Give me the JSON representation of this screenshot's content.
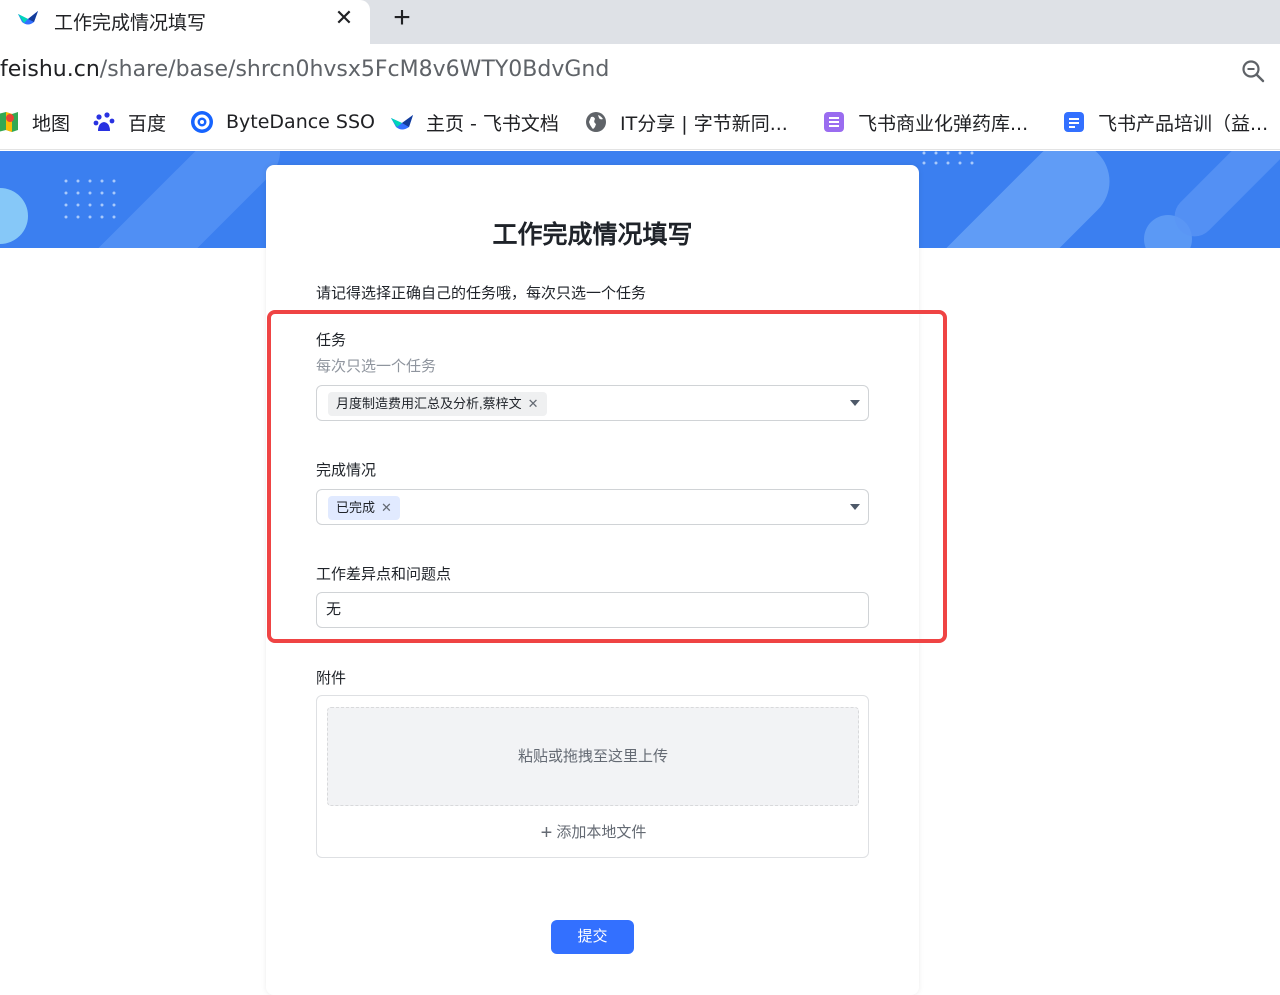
{
  "browser": {
    "tab_title": "工作完成情况填写",
    "tab_close": "✕",
    "new_tab": "+",
    "url_host": "feishu.cn",
    "url_path": "/share/base/shrcn0hvsx5FcM8v6WTY0BdvGnd"
  },
  "bookmarks": [
    {
      "label": "地图",
      "icon": "maps-icon"
    },
    {
      "label": "百度",
      "icon": "baidu-icon"
    },
    {
      "label": "ByteDance SSO",
      "icon": "sso-icon"
    },
    {
      "label": "主页 - 飞书文档",
      "icon": "feishu-icon"
    },
    {
      "label": "IT分享 | 字节新同...",
      "icon": "globe-icon"
    },
    {
      "label": "飞书商业化弹药库...",
      "icon": "list-doc-icon"
    },
    {
      "label": "飞书产品培训（益...",
      "icon": "doc-icon"
    }
  ],
  "form": {
    "title": "工作完成情况填写",
    "description": "请记得选择正确自己的任务哦，每次只选一个任务",
    "task": {
      "label": "任务",
      "hint": "每次只选一个任务",
      "selected": "月度制造费用汇总及分析,蔡梓文"
    },
    "status": {
      "label": "完成情况",
      "selected": "已完成"
    },
    "issues": {
      "label": "工作差异点和问题点",
      "value": "无"
    },
    "attachment": {
      "label": "附件",
      "dropzone_text": "粘贴或拖拽至这里上传",
      "add_file_label": "添加本地文件"
    },
    "submit_label": "提交"
  },
  "colors": {
    "banner": "#3b7ff0",
    "primary": "#3370ff",
    "highlight": "#ef4444"
  }
}
